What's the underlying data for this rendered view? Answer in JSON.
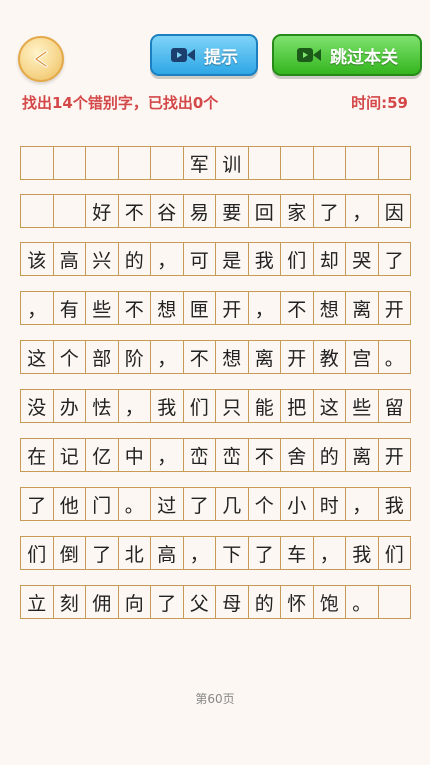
{
  "header": {
    "hint_label": "提示",
    "skip_label": "跳过本关"
  },
  "status": {
    "task_text": "找出14个错别字，已找出0个",
    "timer_text": "时间:59"
  },
  "colors": {
    "accent_red": "#d4484a",
    "grid_border": "#c79a58",
    "hint_blue": "#2ea7e6",
    "skip_green": "#34b51f"
  },
  "grid": {
    "rows": [
      [
        "",
        "",
        "",
        "",
        "",
        "军",
        "训",
        "",
        "",
        "",
        "",
        ""
      ],
      [
        "",
        "",
        "好",
        "不",
        "谷",
        "易",
        "要",
        "回",
        "家",
        "了",
        "，",
        "因"
      ],
      [
        "该",
        "高",
        "兴",
        "的",
        "，",
        "可",
        "是",
        "我",
        "们",
        "却",
        "哭",
        "了"
      ],
      [
        "，",
        "有",
        "些",
        "不",
        "想",
        "匣",
        "开",
        "，",
        "不",
        "想",
        "离",
        "开"
      ],
      [
        "这",
        "个",
        "部",
        "阶",
        "，",
        "不",
        "想",
        "离",
        "开",
        "教",
        "宫",
        "。"
      ],
      [
        "没",
        "办",
        "怯",
        "，",
        "我",
        "们",
        "只",
        "能",
        "把",
        "这",
        "些",
        "留"
      ],
      [
        "在",
        "记",
        "亿",
        "中",
        "，",
        "峦",
        "峦",
        "不",
        "舍",
        "的",
        "离",
        "开"
      ],
      [
        "了",
        "他",
        "门",
        "。",
        "过",
        "了",
        "几",
        "个",
        "小",
        "时",
        "，",
        "我"
      ],
      [
        "们",
        "倒",
        "了",
        "北",
        "高",
        "，",
        "下",
        "了",
        "车",
        "，",
        "我",
        "们"
      ],
      [
        "立",
        "刻",
        "佣",
        "向",
        "了",
        "父",
        "母",
        "的",
        "怀",
        "饱",
        "。",
        ""
      ]
    ]
  },
  "footer": {
    "page_label": "第60页"
  }
}
